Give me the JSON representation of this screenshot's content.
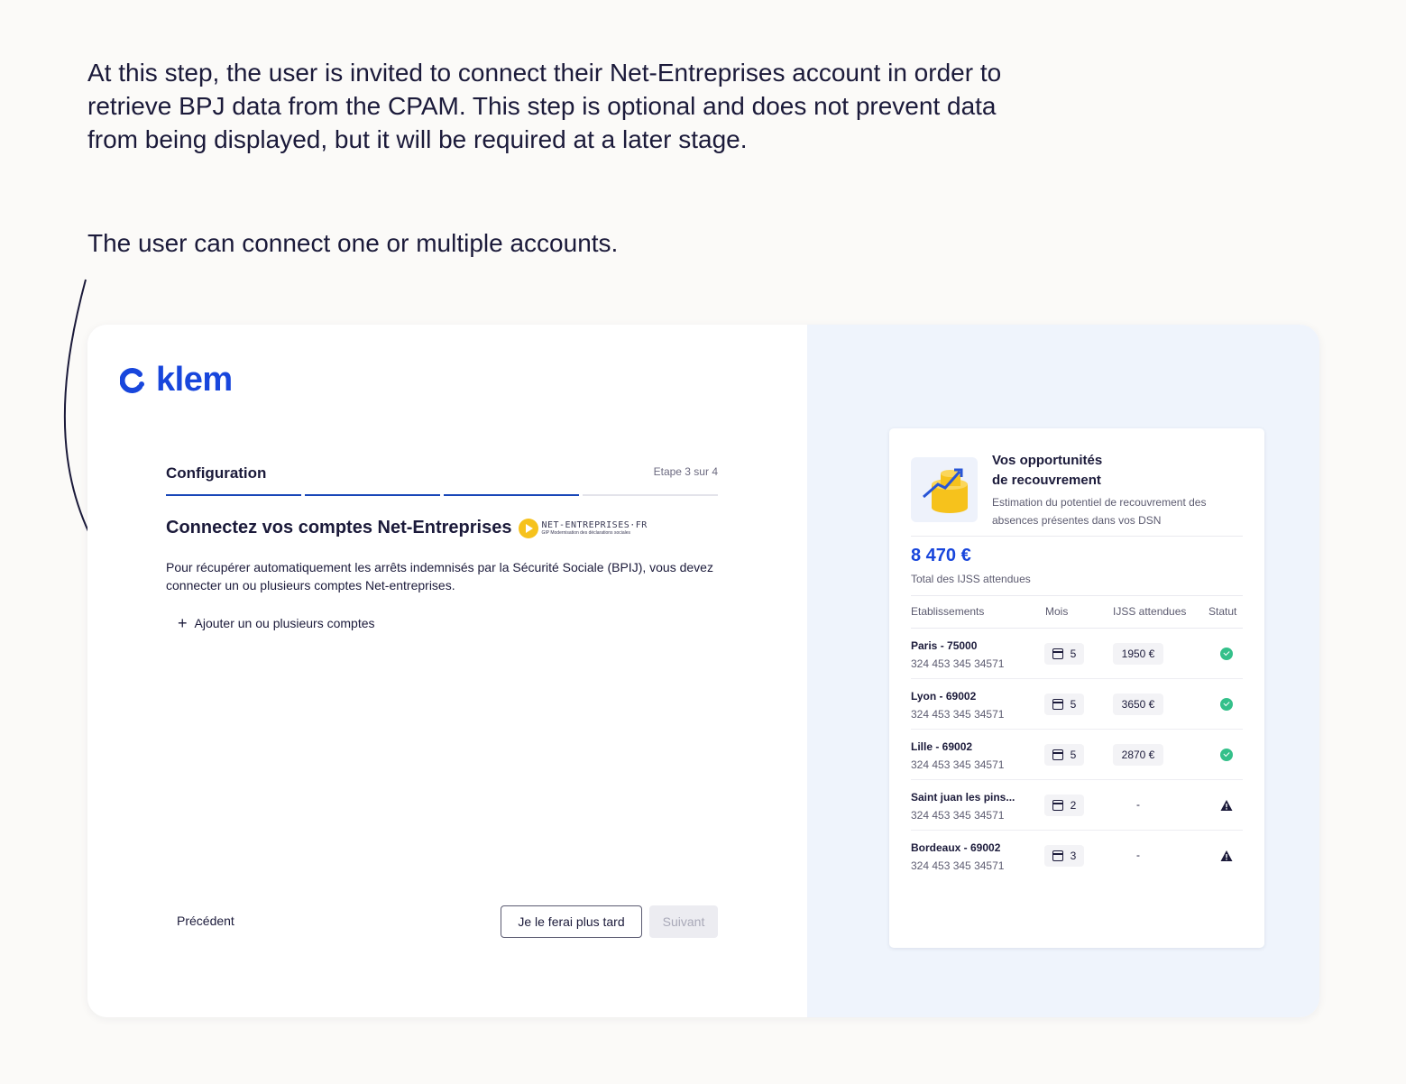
{
  "intro": {
    "paragraph1": "At this step, the user is invited to connect their Net-Entreprises account in order to retrieve BPJ data from the CPAM. This step is optional and does not prevent data from being displayed, but it will be required at a later stage.",
    "paragraph2": "The user can connect one or multiple accounts."
  },
  "app": {
    "logo_text": "klem",
    "step_title": "Configuration",
    "step_count": "Etape 3 sur 4",
    "progress": {
      "current": 3,
      "total": 4
    },
    "heading": "Connectez vos comptes Net-Entreprises",
    "ne_logo": {
      "name": "NET-ENTREPRISES·FR",
      "tagline": "GIP Modernisation des déclarations sociales"
    },
    "description": "Pour récupérer automatiquement les arrêts indemnisés par la Sécurité Sociale (BPIJ), vous devez connecter un ou plusieurs comptes Net-entreprises.",
    "add_accounts": "Ajouter un ou plusieurs comptes",
    "prev_label": "Précédent",
    "later_label": "Je le ferai plus tard",
    "next_label": "Suivant"
  },
  "card": {
    "title_line1": "Vos opportunités",
    "title_line2": "de recouvrement",
    "subtitle": "Estimation du potentiel de recouvrement des absences présentes dans vos DSN",
    "total": "8 470 €",
    "total_label": "Total des IJSS attendues",
    "columns": [
      "Etablissements",
      "Mois",
      "IJSS attendues",
      "Statut"
    ],
    "rows": [
      {
        "name": "Paris - 75000",
        "siret": "324 453 345 34571",
        "mois": "5",
        "amount": "1950 €",
        "status": "ok",
        "status_icon": "check-circle-icon"
      },
      {
        "name": "Lyon - 69002",
        "siret": "324 453 345 34571",
        "mois": "5",
        "amount": "3650 €",
        "status": "ok",
        "status_icon": "check-circle-icon"
      },
      {
        "name": "Lille - 69002",
        "siret": "324 453 345 34571",
        "mois": "5",
        "amount": "2870 €",
        "status": "ok",
        "status_icon": "check-circle-icon"
      },
      {
        "name": "Saint juan les pins...",
        "siret": "324 453 345 34571",
        "mois": "2",
        "amount": "-",
        "status": "warning",
        "status_icon": "warning-triangle-icon"
      },
      {
        "name": "Bordeaux - 69002",
        "siret": "324 453 345 34571",
        "mois": "3",
        "amount": "-",
        "status": "warning",
        "status_icon": "warning-triangle-icon"
      }
    ]
  },
  "colors": {
    "brand": "#1846dc",
    "success": "#34c08a",
    "warning": "#1b1a3a",
    "right_bg": "#eff4fc"
  }
}
